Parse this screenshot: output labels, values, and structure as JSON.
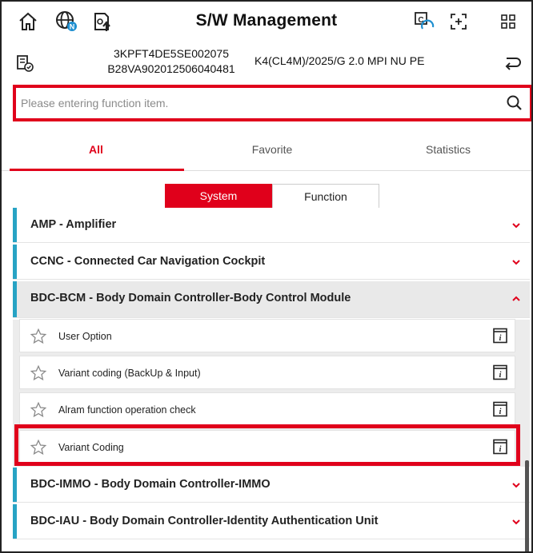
{
  "header": {
    "title": "S/W Management",
    "icons": [
      "home-icon",
      "globe-network-icon",
      "upload-device-icon",
      "cloud-sync-icon",
      "screen-capture-icon",
      "grid-menu-icon"
    ]
  },
  "vehicle": {
    "vin": "3KPFT4DE5SE002075",
    "code": "B28VA902012506040481",
    "model": "K4(CL4M)/2025/G 2.0 MPI NU PE",
    "icons": [
      "vehicle-check-icon",
      "return-icon"
    ]
  },
  "search": {
    "placeholder": "Please entering function item."
  },
  "tabs": [
    {
      "label": "All",
      "active": true
    },
    {
      "label": "Favorite",
      "active": false
    },
    {
      "label": "Statistics",
      "active": false
    }
  ],
  "toggle": {
    "system": "System",
    "function": "Function"
  },
  "categories": [
    {
      "label": "AMP - Amplifier",
      "expanded": false
    },
    {
      "label": "CCNC - Connected Car Navigation Cockpit",
      "expanded": false
    },
    {
      "label": "BDC-BCM - Body Domain Controller-Body Control Module",
      "expanded": true
    },
    {
      "label": "BDC-IMMO - Body Domain Controller-IMMO",
      "expanded": false
    },
    {
      "label": "BDC-IAU - Body Domain Controller-Identity Authentication Unit",
      "expanded": false
    }
  ],
  "functions": [
    {
      "label": "User Option"
    },
    {
      "label": "Variant coding (BackUp & Input)"
    },
    {
      "label": "Alram function operation check"
    },
    {
      "label": "Variant Coding"
    }
  ],
  "colors": {
    "accent_red": "#e0001b",
    "category_bar": "#27a3c4"
  }
}
